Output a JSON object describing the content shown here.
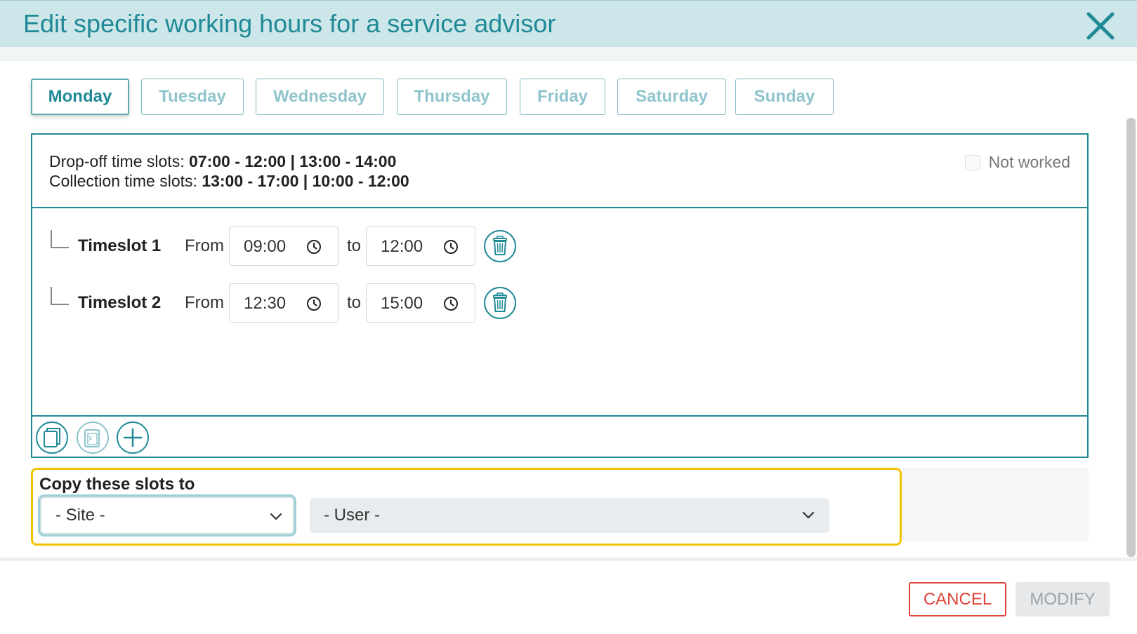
{
  "dialog": {
    "title": "Edit specific working hours for a service advisor"
  },
  "tabs": [
    {
      "label": "Monday",
      "active": true
    },
    {
      "label": "Tuesday",
      "active": false
    },
    {
      "label": "Wednesday",
      "active": false
    },
    {
      "label": "Thursday",
      "active": false
    },
    {
      "label": "Friday",
      "active": false
    },
    {
      "label": "Saturday",
      "active": false
    },
    {
      "label": "Sunday",
      "active": false
    }
  ],
  "info": {
    "dropoff_label": "Drop-off time slots: ",
    "dropoff_value": "07:00 - 12:00 | 13:00 - 14:00",
    "collection_label": "Collection time slots: ",
    "collection_value": "13:00 - 17:00 | 10:00 - 12:00",
    "not_worked_label": "Not worked",
    "not_worked_checked": false
  },
  "timeslots": [
    {
      "label": "Timeslot 1",
      "from_label": "From",
      "from": "09:00",
      "to_label": "to",
      "to": "12:00"
    },
    {
      "label": "Timeslot 2",
      "from_label": "From",
      "from": "12:30",
      "to_label": "to",
      "to": "15:00"
    }
  ],
  "toolbar": {
    "icons": [
      "copy-icon",
      "paste-icon",
      "add-icon"
    ]
  },
  "copy": {
    "title": "Copy these slots to",
    "site_value": "- Site -",
    "user_value": "- User -"
  },
  "footer": {
    "cancel_label": "CANCEL",
    "modify_label": "MODIFY"
  },
  "colors": {
    "accent": "#1f8a96",
    "header_bg": "#cde6ea",
    "highlight": "#f2c200",
    "danger": "#e0443a"
  }
}
